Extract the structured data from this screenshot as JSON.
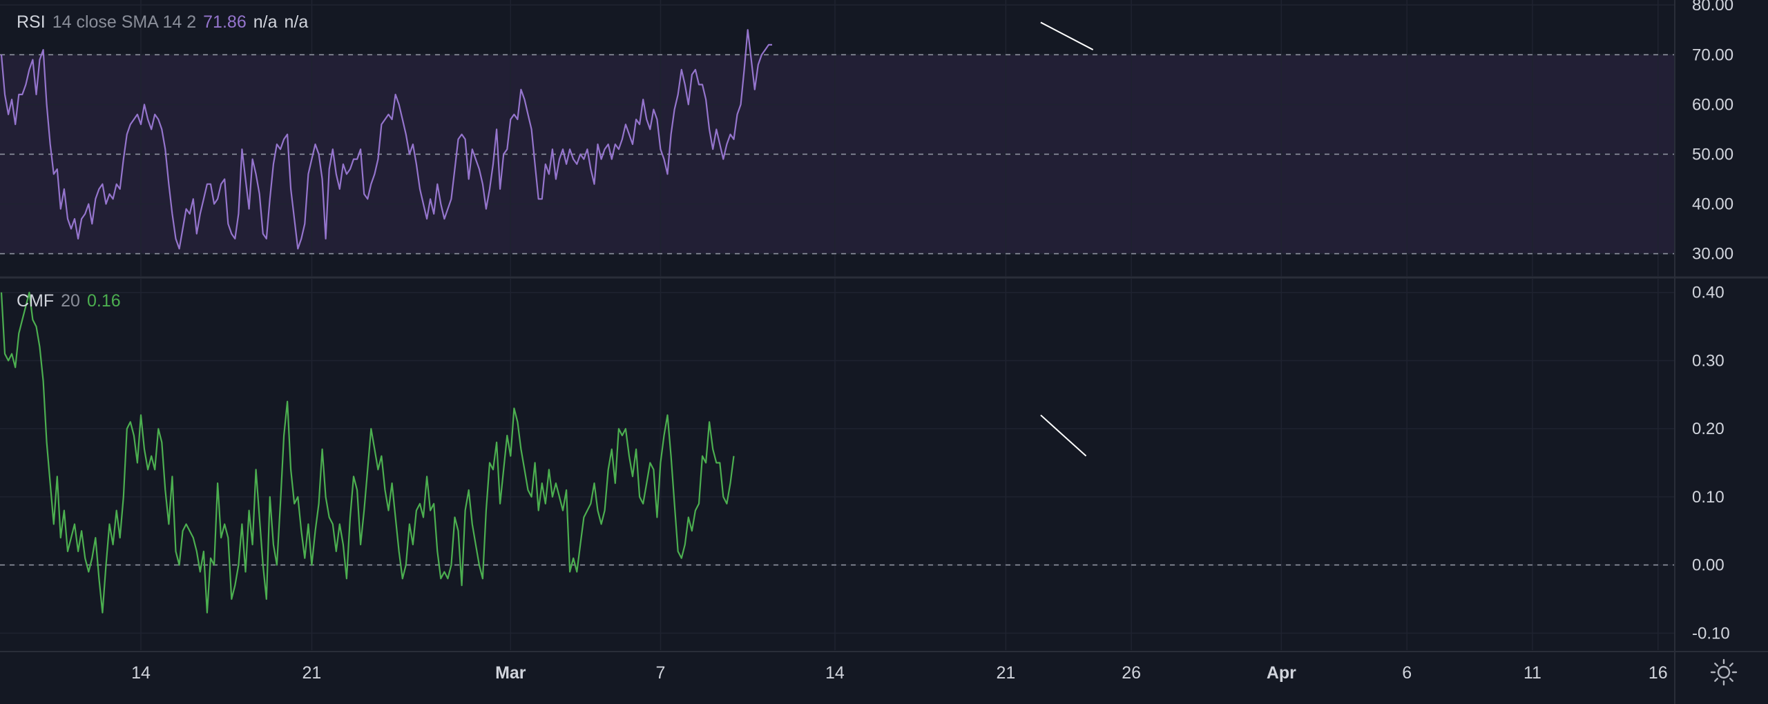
{
  "rsi_legend": {
    "name": "RSI",
    "params": "14 close SMA 14 2",
    "value": "71.86",
    "na1": "n/a",
    "na2": "n/a"
  },
  "cmf_legend": {
    "name": "CMF",
    "params": "20",
    "value": "0.16"
  },
  "colors": {
    "background": "#141823",
    "rsi_line": "#9575cd",
    "rsi_band": "#221f35",
    "cmf_line": "#4caf50",
    "grid": "#1f2330",
    "axis_text": "#d1d4dc",
    "trendline": "#ffffff"
  },
  "icons": {
    "settings": "gear-icon"
  },
  "chart_data": [
    {
      "type": "line",
      "name": "RSI",
      "y_ticks": [
        80.0,
        70.0,
        60.0,
        50.0,
        40.0,
        30.0
      ],
      "ylim": [
        25.5,
        81
      ],
      "band": [
        30,
        70
      ],
      "dashed_levels": [
        70,
        50,
        30
      ],
      "last_value": 71.86,
      "values": [
        70,
        62,
        58,
        61,
        56,
        62,
        62,
        64,
        67,
        69,
        62,
        69,
        71,
        60,
        52,
        46,
        47,
        39,
        43,
        37,
        35,
        37,
        33,
        37,
        38,
        40,
        36,
        41,
        43,
        44,
        40,
        42,
        41,
        44,
        43,
        49,
        54,
        56,
        57,
        58,
        56,
        60,
        57,
        55,
        58,
        57,
        55,
        51,
        44,
        38,
        33,
        31,
        35,
        39,
        38,
        41,
        34,
        38,
        41,
        44,
        44,
        40,
        41,
        44,
        45,
        36,
        34,
        33,
        38,
        51,
        45,
        39,
        49,
        46,
        42,
        34,
        33,
        41,
        48,
        52,
        51,
        53,
        54,
        43,
        37,
        31,
        33,
        36,
        46,
        49,
        52,
        50,
        45,
        33,
        47,
        51,
        46,
        43,
        48,
        46,
        47,
        49,
        49,
        51,
        42,
        41,
        44,
        46,
        49,
        56,
        57,
        58,
        57,
        62,
        60,
        57,
        54,
        50,
        52,
        48,
        43,
        40,
        37,
        41,
        38,
        44,
        40,
        37,
        39,
        41,
        47,
        53,
        54,
        53,
        45,
        51,
        49,
        47,
        44,
        39,
        43,
        48,
        55,
        43,
        50,
        51,
        57,
        58,
        57,
        63,
        61,
        58,
        55,
        48,
        41,
        41,
        48,
        46,
        51,
        45,
        49,
        51,
        48,
        51,
        49,
        48,
        50,
        49,
        51,
        47,
        44,
        52,
        49,
        51,
        52,
        49,
        52,
        51,
        53,
        56,
        54,
        52,
        57,
        56,
        61,
        57,
        55,
        59,
        57,
        51,
        49,
        46,
        54,
        59,
        62,
        67,
        64,
        60,
        66,
        67,
        64,
        64,
        61,
        55,
        51,
        55,
        52,
        49,
        52,
        54,
        53,
        58,
        60,
        67,
        75,
        69,
        63,
        68,
        70,
        71,
        72,
        72
      ]
    },
    {
      "type": "line",
      "name": "CMF",
      "y_ticks": [
        0.4,
        0.3,
        0.2,
        0.1,
        0.0,
        -0.1
      ],
      "ylim": [
        -0.125,
        0.42
      ],
      "dashed_levels": [
        0
      ],
      "last_value": 0.16,
      "values": [
        0.4,
        0.31,
        0.3,
        0.31,
        0.29,
        0.34,
        0.36,
        0.38,
        0.4,
        0.36,
        0.35,
        0.32,
        0.27,
        0.18,
        0.12,
        0.06,
        0.13,
        0.04,
        0.08,
        0.02,
        0.04,
        0.06,
        0.02,
        0.05,
        0.01,
        -0.01,
        0.01,
        0.04,
        -0.02,
        -0.07,
        0.0,
        0.06,
        0.03,
        0.08,
        0.04,
        0.1,
        0.2,
        0.21,
        0.19,
        0.15,
        0.22,
        0.17,
        0.14,
        0.16,
        0.14,
        0.2,
        0.18,
        0.11,
        0.06,
        0.13,
        0.02,
        0.0,
        0.05,
        0.06,
        0.05,
        0.04,
        0.02,
        -0.01,
        0.02,
        -0.07,
        0.01,
        0.0,
        0.12,
        0.04,
        0.06,
        0.04,
        -0.05,
        -0.03,
        0.0,
        0.06,
        -0.01,
        0.08,
        0.03,
        0.14,
        0.07,
        0.0,
        -0.05,
        0.1,
        0.03,
        0.0,
        0.09,
        0.19,
        0.24,
        0.14,
        0.09,
        0.1,
        0.05,
        0.01,
        0.06,
        0.0,
        0.05,
        0.09,
        0.17,
        0.1,
        0.07,
        0.06,
        0.02,
        0.06,
        0.03,
        -0.02,
        0.07,
        0.13,
        0.11,
        0.03,
        0.08,
        0.14,
        0.2,
        0.17,
        0.14,
        0.16,
        0.11,
        0.08,
        0.12,
        0.07,
        0.02,
        -0.02,
        0.0,
        0.06,
        0.03,
        0.08,
        0.09,
        0.07,
        0.13,
        0.08,
        0.09,
        0.02,
        -0.02,
        -0.01,
        -0.02,
        0.0,
        0.07,
        0.05,
        -0.03,
        0.08,
        0.11,
        0.06,
        0.03,
        0.0,
        -0.02,
        0.08,
        0.15,
        0.14,
        0.18,
        0.09,
        0.14,
        0.19,
        0.16,
        0.23,
        0.21,
        0.17,
        0.14,
        0.11,
        0.1,
        0.15,
        0.08,
        0.12,
        0.09,
        0.14,
        0.1,
        0.12,
        0.1,
        0.08,
        0.11,
        -0.01,
        0.01,
        -0.01,
        0.03,
        0.07,
        0.08,
        0.09,
        0.12,
        0.08,
        0.06,
        0.08,
        0.14,
        0.17,
        0.12,
        0.2,
        0.19,
        0.2,
        0.16,
        0.13,
        0.17,
        0.1,
        0.09,
        0.12,
        0.15,
        0.14,
        0.07,
        0.15,
        0.19,
        0.22,
        0.16,
        0.09,
        0.02,
        0.01,
        0.03,
        0.07,
        0.05,
        0.08,
        0.09,
        0.16,
        0.15,
        0.21,
        0.17,
        0.15,
        0.15,
        0.1,
        0.09,
        0.12,
        0.16
      ]
    }
  ],
  "x_axis": {
    "ticks": [
      {
        "label": "14",
        "bar": 40
      },
      {
        "label": "21",
        "bar": 89
      },
      {
        "label": "Mar",
        "bar": 146
      },
      {
        "label": "7",
        "bar": 189
      },
      {
        "label": "14",
        "bar": 239
      },
      {
        "label": "21",
        "bar": 288
      },
      {
        "label": "26",
        "bar": 324
      },
      {
        "label": "Apr",
        "bar": 367
      },
      {
        "label": "6",
        "bar": 403
      },
      {
        "label": "11",
        "bar": 439
      },
      {
        "label": "16",
        "bar": 475
      }
    ],
    "bold_labels": [
      "Mar",
      "Apr"
    ]
  },
  "annotations": [
    {
      "pane": "RSI",
      "from": {
        "bar": 298,
        "value": 76.5
      },
      "to": {
        "bar": 313,
        "value": 71
      }
    },
    {
      "pane": "CMF",
      "from": {
        "bar": 298,
        "value": 0.22
      },
      "to": {
        "bar": 311,
        "value": 0.16
      }
    }
  ]
}
